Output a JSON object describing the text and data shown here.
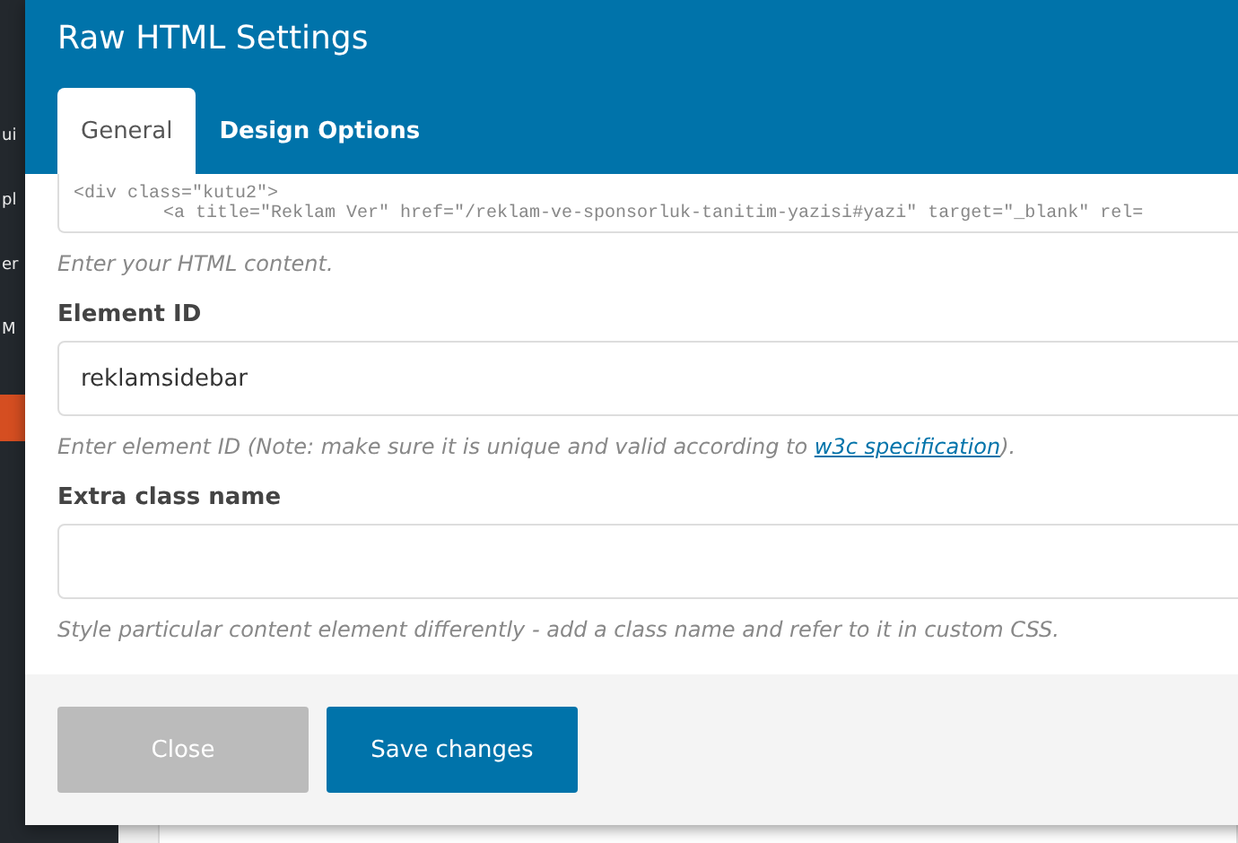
{
  "background_menu": [
    {
      "label": "ui",
      "selected": false
    },
    {
      "label": "pl",
      "selected": false
    },
    {
      "label": "er",
      "selected": false
    },
    {
      "label": "M",
      "selected": false
    },
    {
      "selected": true
    }
  ],
  "dialog": {
    "title": "Raw HTML Settings",
    "tabs": [
      {
        "label": "General",
        "selected": true
      },
      {
        "label": "Design Options",
        "selected": false
      }
    ],
    "code_lines": [
      "<div class=\"kutu2\">",
      "<a title=\"Reklam Ver\" href=\"/reklam-ve-sponsorluk-tanitim-yazisi#yazi\" target=\"_blank\" rel="
    ],
    "code_help": "Enter your HTML content.",
    "fields": [
      {
        "label": "Element ID",
        "value": "reklamsidebar",
        "help": "Enter element ID (Note: make sure it is unique and valid according to ",
        "link": "w3c specification",
        "help_end": ")."
      },
      {
        "label": "Extra class name",
        "help": "Style particular content element differently - add a class name and refer to it in custom CSS."
      }
    ],
    "buttons": [
      {
        "label": "Close",
        "kind": "secondary"
      },
      {
        "label": "Save changes",
        "kind": "primary"
      }
    ]
  }
}
